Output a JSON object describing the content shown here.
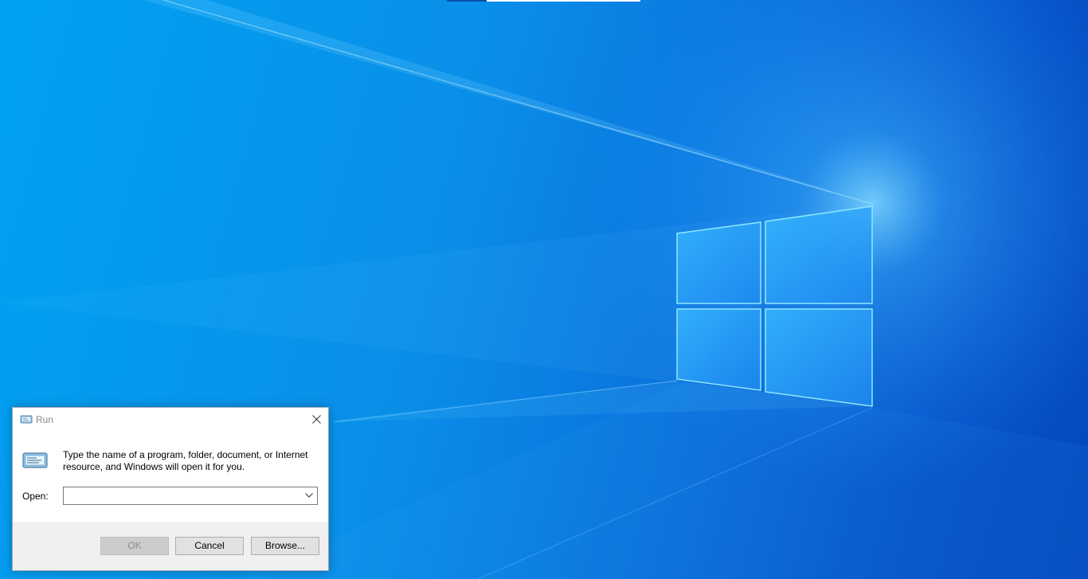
{
  "desktop": {
    "wallpaper": "windows-10-hero-logo",
    "colors": {
      "background_light": "#00a2f2",
      "background_dark": "#0548bd",
      "logo_pane": "#36b3ff"
    }
  },
  "run_dialog": {
    "title": "Run",
    "title_icon": "run-icon",
    "close_icon": "close-icon",
    "big_icon": "run-icon",
    "instructions": "Type the name of a program, folder, document, or Internet resource, and Windows will open it for you.",
    "open_label": "Open:",
    "open_value": "",
    "dropdown_icon": "chevron-down-icon",
    "buttons": {
      "ok": "OK",
      "cancel": "Cancel",
      "browse": "Browse..."
    }
  }
}
